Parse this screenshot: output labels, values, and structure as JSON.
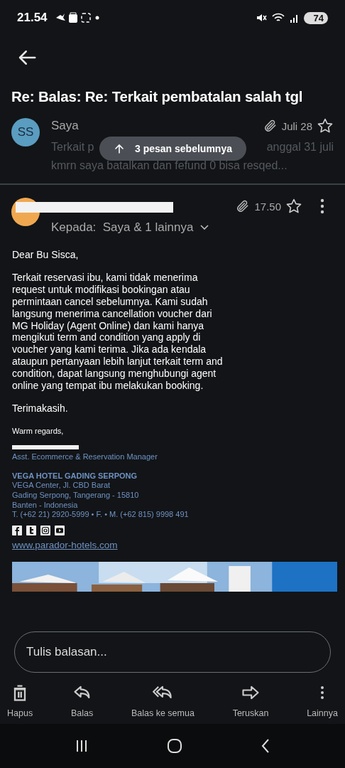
{
  "status_bar": {
    "time": "21.54",
    "battery": "74"
  },
  "subject": "Re: Balas: Re: Terkait pembatalan salah tgl",
  "earlier_message": {
    "sender": "Saya",
    "avatar_initials": "SS",
    "has_attachment": true,
    "date": "Juli 28",
    "starred": false,
    "preview_start": "Terkait p",
    "preview_end": "anggal 31 juli",
    "preview_line_2": "kmrn saya batalkan dan fefund 0 bisa resqed..."
  },
  "earlier_pill": {
    "label": "3 pesan sebelumnya"
  },
  "message": {
    "has_attachment": true,
    "time": "17.50",
    "starred": false,
    "recipients": "Kepada:  Saya & 1 lainnya",
    "body": [
      "Dear Bu Sisca,",
      "Terkait reservasi ibu, kami tidak menerima request untuk modifikasi bookingan atau permintaan cancel sebelumnya. Kami sudah langsung menerima cancellation voucher dari MG Holiday (Agent Online) dan kami hanya mengikuti term and condition yang apply di voucher yang kami terima. Jika ada kendala ataupun pertanyaan lebih lanjut terkait term and condition, dapat langsung menghubungi agent online yang tempat ibu melakukan booking.",
      "Terimakasih."
    ],
    "closing": "Warm regards,",
    "signature": {
      "title": "Asst. Ecommerce & Reservation Manager",
      "hotel": "VEGA HOTEL GADING SERPONG",
      "address": [
        "VEGA Center, Jl. CBD Barat",
        "Gading Serpong, Tangerang - 15810",
        "Banten - Indonesia",
        "T. (+62 21) 2920-5999 • F.  • M. (+62 815) 9998 491"
      ],
      "website": "www.parador-hotels.com"
    }
  },
  "reply_field": {
    "placeholder": "Tulis balasan..."
  },
  "actions": [
    {
      "kind": "delete",
      "label": "Hapus"
    },
    {
      "kind": "reply",
      "label": "Balas"
    },
    {
      "kind": "reply_all",
      "label": "Balas ke semua"
    },
    {
      "kind": "forward",
      "label": "Teruskan"
    },
    {
      "kind": "more",
      "label": "Lainnya"
    }
  ]
}
